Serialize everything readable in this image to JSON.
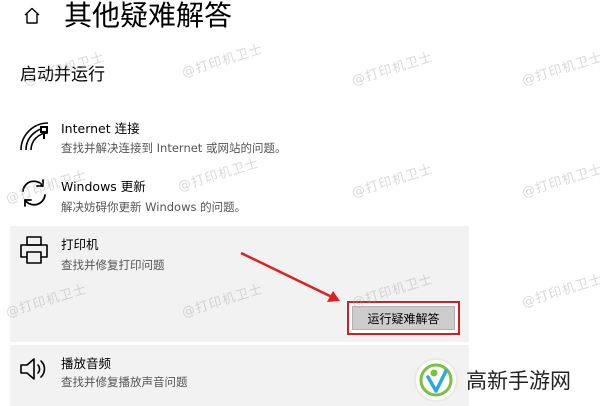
{
  "header": {
    "home_icon": "home-icon",
    "title": "其他疑难解答"
  },
  "section": {
    "title": "启动并运行"
  },
  "items": [
    {
      "icon": "wifi-signal-icon",
      "name": "Internet 连接",
      "description": "查找并解决连接到 Internet 或网站的问题。"
    },
    {
      "icon": "refresh-icon",
      "name": "Windows 更新",
      "description": "解决妨碍你更新 Windows 的问题。"
    },
    {
      "icon": "printer-icon",
      "name": "打印机",
      "description": "查找并修复打印问题",
      "action_label": "运行疑难解答"
    },
    {
      "icon": "speaker-icon",
      "name": "播放音频",
      "description": "查找并修复播放声音问题"
    }
  ],
  "watermark": {
    "text": "@打印机卫士"
  },
  "brand": {
    "name": "高新手游网"
  },
  "colors": {
    "highlight": "#d22020",
    "item_bg": "#f2f2f2",
    "button_bg": "#cccccc",
    "watermark": "#aaaaaa"
  }
}
